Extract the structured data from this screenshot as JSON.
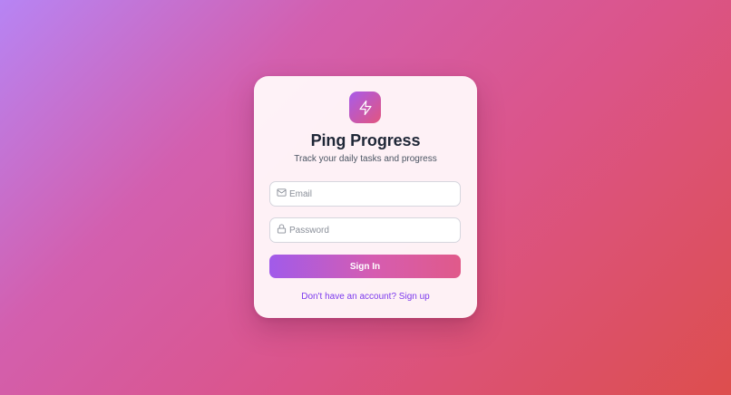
{
  "app": {
    "title": "Ping Progress",
    "subtitle": "Track your daily tasks and progress",
    "logo_icon": "lightning-bolt-icon"
  },
  "form": {
    "email": {
      "placeholder": "Email",
      "value": "",
      "icon": "mail-icon"
    },
    "password": {
      "placeholder": "Password",
      "value": "",
      "icon": "lock-icon"
    },
    "submit_label": "Sign In",
    "signup_text": "Don't have an account? Sign up"
  },
  "colors": {
    "accent_start": "#a15bea",
    "accent_end": "#e05a8a",
    "link": "#7c3aed",
    "title": "#1f2737"
  }
}
